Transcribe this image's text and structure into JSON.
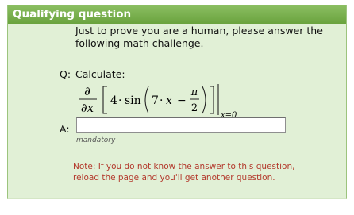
{
  "header": {
    "title": "Qualifying question"
  },
  "intro": {
    "line1": "Just to prove you are a human, please answer the",
    "line2": "following math challenge."
  },
  "question": {
    "label": "Q:",
    "prompt": "Calculate:",
    "formula": {
      "partial_num": "∂",
      "partial_den": "∂x",
      "coef": "4",
      "dot": "·",
      "func": "sin",
      "inner_coef": "7",
      "var": "x",
      "minus": "−",
      "pi": "π",
      "two": "2",
      "eval_at": "x=0"
    }
  },
  "answer": {
    "label": "A:",
    "value": "",
    "hint": "mandatory"
  },
  "note": {
    "line1": "Note: If you do not know the answer to this question,",
    "line2": "reload the page and you'll get another question."
  },
  "colors": {
    "header_bg": "#7bb24f",
    "panel_bg": "#e1f0d6",
    "note_text": "#b3392c"
  }
}
